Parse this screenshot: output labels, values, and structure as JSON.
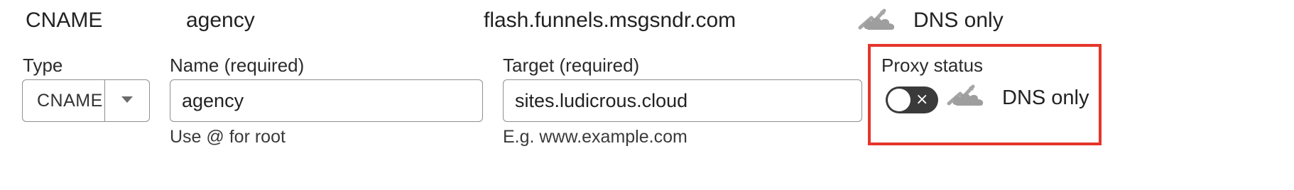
{
  "record": {
    "type": "CNAME",
    "name": "agency",
    "target": "flash.funnels.msgsndr.com",
    "proxy_status": "DNS only"
  },
  "form": {
    "type": {
      "label": "Type",
      "value": "CNAME"
    },
    "name": {
      "label": "Name (required)",
      "value": "agency",
      "help": "Use @ for root"
    },
    "target": {
      "label": "Target (required)",
      "value": "sites.ludicrous.cloud",
      "help": "E.g. www.example.com"
    },
    "proxy": {
      "label": "Proxy status",
      "toggle_on": false,
      "toggle_glyph": "×",
      "status_text": "DNS only"
    }
  },
  "icons": {
    "cloud_dns_only": "cloud-dns-only-icon",
    "dropdown_caret": "chevron-down-icon"
  },
  "colors": {
    "highlight": "#e5352b",
    "cloud_gray": "#9e9e9e",
    "toggle_off": "#3a3a3a"
  }
}
